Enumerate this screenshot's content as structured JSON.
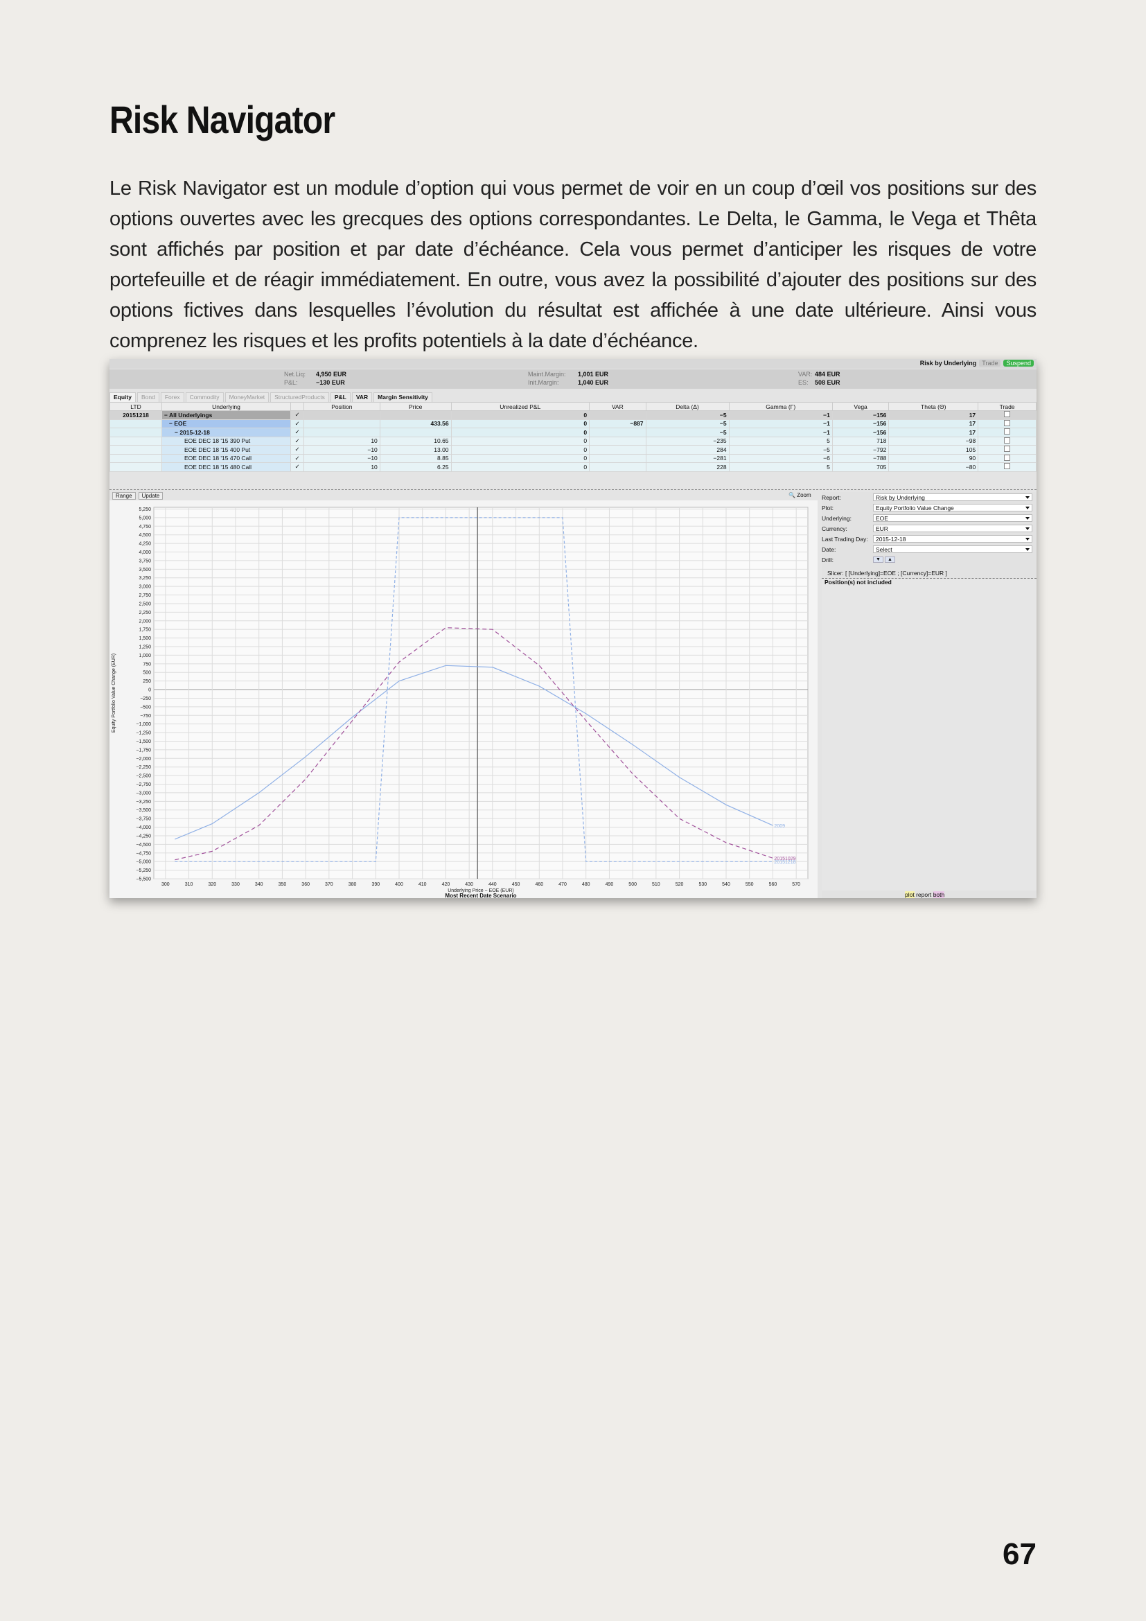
{
  "page": {
    "title": "Risk Navigator",
    "intro": "Le Risk Navigator est un module d’option qui vous permet de voir en un coup d’œil vos positions sur des options ouvertes avec les grecques des options correspondantes. Le Delta, le Gamma, le Vega et Thêta sont affichés par position et par date d’échéance. Cela vous permet d’anticiper les risques de votre portefeuille et de réagir immédiatement. En outre, vous avez la possibilité d’ajouter des positions sur des options fictives dans lesquelles l’évolution du résultat est affichée à une date ultérieure. Ainsi vous comprenez les risques et les profits potentiels à la date d’échéance.",
    "page_number": "67"
  },
  "app": {
    "topbar": {
      "report_title": "Risk by Underlying",
      "trade": "Trade",
      "suspend": "Suspend"
    },
    "account": {
      "net_liq_label": "Net.Liq:",
      "net_liq": "4,950 EUR",
      "pnl_label": "P&L:",
      "pnl": "−130 EUR",
      "maint_label": "Maint.Margin:",
      "maint": "1,001 EUR",
      "init_label": "Init.Margin:",
      "init": "1,040 EUR",
      "var_label": "VAR:",
      "var": "484 EUR",
      "es_label": "ES:",
      "es": "508 EUR"
    },
    "asset_tabs": [
      "Equity",
      "Bond",
      "Forex",
      "Commodity",
      "MoneyMarket",
      "StructuredProducts",
      "P&L",
      "VAR",
      "Margin Sensitivity"
    ],
    "table": {
      "headers": [
        "LTD",
        "Underlying",
        "",
        "Position",
        "Price",
        "Unrealized P&L",
        "VAR",
        "Delta (Δ)",
        "Gamma (Γ)",
        "Vega",
        "Theta (Θ)",
        "Trade"
      ],
      "rows": [
        {
          "ltd": "20151218",
          "underlying": "− All Underlyings",
          "check": "✓",
          "position": "",
          "price": "",
          "upnl": "0",
          "var": "",
          "delta": "−5",
          "gamma": "−1",
          "vega": "−156",
          "theta": "17"
        },
        {
          "ltd": "",
          "underlying": "− EOE",
          "check": "✓",
          "position": "",
          "price": "433.56",
          "upnl": "0",
          "var": "−887",
          "delta": "−5",
          "gamma": "−1",
          "vega": "−156",
          "theta": "17"
        },
        {
          "ltd": "",
          "underlying": "− 2015-12-18",
          "check": "✓",
          "position": "",
          "price": "",
          "upnl": "0",
          "var": "",
          "delta": "−5",
          "gamma": "−1",
          "vega": "−156",
          "theta": "17"
        },
        {
          "ltd": "",
          "underlying": "EOE DEC 18 '15 390 Put",
          "check": "✓",
          "position": "10",
          "price": "10.65",
          "upnl": "0",
          "var": "",
          "delta": "−235",
          "gamma": "5",
          "vega": "718",
          "theta": "−98"
        },
        {
          "ltd": "",
          "underlying": "EOE DEC 18 '15 400 Put",
          "check": "✓",
          "position": "−10",
          "price": "13.00",
          "upnl": "0",
          "var": "",
          "delta": "284",
          "gamma": "−5",
          "vega": "−792",
          "theta": "105"
        },
        {
          "ltd": "",
          "underlying": "EOE DEC 18 '15 470 Call",
          "check": "✓",
          "position": "−10",
          "price": "8.85",
          "upnl": "0",
          "var": "",
          "delta": "−281",
          "gamma": "−6",
          "vega": "−788",
          "theta": "90"
        },
        {
          "ltd": "",
          "underlying": "EOE DEC 18 '15 480 Call",
          "check": "✓",
          "position": "10",
          "price": "6.25",
          "upnl": "0",
          "var": "",
          "delta": "228",
          "gamma": "5",
          "vega": "705",
          "theta": "−80"
        }
      ]
    },
    "chart_controls": {
      "range": "Range",
      "update": "Update",
      "zoom": "Zoom"
    },
    "panel": {
      "report_label": "Report:",
      "report": "Risk by Underlying",
      "plot_label": "Plot:",
      "plot": "Equity Portfolio Value Change",
      "underlying_label": "Underlying:",
      "underlying": "EOE",
      "currency_label": "Currency:",
      "currency": "EUR",
      "ltd_label": "Last Trading Day:",
      "ltd": "2015-12-18",
      "date_label": "Date:",
      "date": "Select",
      "drill_label": "Drill:",
      "slicer": "Slicer: [ [Underlying]=EOE ; [Currency]=EUR ]",
      "positions_title": "Position(s) not included",
      "footer_plot": "plot",
      "footer_report": "report",
      "footer_both": "both"
    }
  },
  "chart_data": {
    "type": "line",
    "xlabel": "Underlying Price − EOE (EUR)",
    "ylabel": "Equity Portfolio Value Change (EUR)",
    "caption": "Most Recent Date Scenario",
    "xlim": [
      295,
      575
    ],
    "ylim": [
      -5500,
      5300
    ],
    "x_ticks": [
      300,
      310,
      320,
      330,
      340,
      350,
      360,
      370,
      380,
      390,
      400,
      410,
      420,
      430,
      440,
      450,
      460,
      470,
      480,
      490,
      500,
      510,
      520,
      530,
      540,
      550,
      560,
      570
    ],
    "y_ticks": [
      5250,
      5000,
      4750,
      4500,
      4250,
      4000,
      3750,
      3500,
      3250,
      3000,
      2750,
      2500,
      2250,
      2000,
      1750,
      1500,
      1250,
      1000,
      750,
      500,
      250,
      0,
      -250,
      -500,
      -750,
      -1000,
      -1250,
      -1500,
      -1750,
      -2000,
      -2250,
      -2500,
      -2750,
      -3000,
      -3250,
      -3500,
      -3750,
      -4000,
      -4250,
      -4500,
      -4750,
      -5000,
      -5250,
      -5500
    ],
    "current_price": 433.56,
    "series": [
      {
        "name": "2009",
        "color": "#8fb0e6",
        "dash": "none",
        "x": [
          304,
          320,
          340,
          360,
          380,
          400,
          420,
          440,
          460,
          480,
          500,
          520,
          540,
          560
        ],
        "y": [
          -4350,
          -3900,
          -3000,
          -1950,
          -800,
          250,
          700,
          650,
          100,
          -700,
          -1600,
          -2550,
          -3350,
          -3950
        ]
      },
      {
        "name": "20151029",
        "color": "#a0509a",
        "dash": "6,4",
        "x": [
          304,
          320,
          340,
          360,
          380,
          400,
          420,
          440,
          460,
          480,
          500,
          520,
          540,
          560
        ],
        "y": [
          -4950,
          -4700,
          -3950,
          -2600,
          -900,
          800,
          1800,
          1750,
          700,
          -900,
          -2450,
          -3750,
          -4450,
          -4900
        ]
      },
      {
        "name": "20151218",
        "color": "#8fb0e6",
        "dash": "4,3",
        "x": [
          304,
          390,
          400,
          470,
          480,
          560
        ],
        "y": [
          -5000,
          -5000,
          5000,
          5000,
          -5000,
          -5000
        ]
      }
    ]
  }
}
